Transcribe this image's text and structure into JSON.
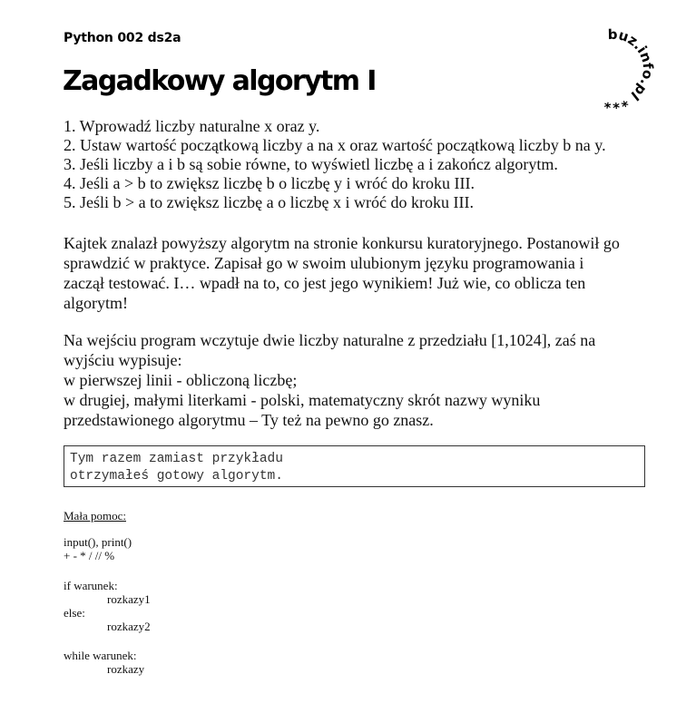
{
  "header": {
    "code": "Python 002 ds2a",
    "title": "Zagadkowy algorytm I"
  },
  "logo": {
    "text": "buz.info.pl ***"
  },
  "steps": [
    "1. Wprowadź liczby naturalne x oraz y.",
    "2. Ustaw wartość początkową liczby a na x oraz wartość początkową liczby b na y.",
    "3. Jeśli liczby a i b są sobie równe, to wyświetl liczbę a i zakończ algorytm.",
    "4. Jeśli a > b to zwiększ liczbę b o liczbę y i wróć do kroku III.",
    "5. Jeśli b > a to zwiększ liczbę a o liczbę x i wróć do kroku III."
  ],
  "story": {
    "lines": [
      "Kajtek znalazł powyższy algorytm na stronie konkursu kuratoryjnego. Postanowił go",
      "sprawdzić w praktyce. Zapisał go w swoim ulubionym języku programowania i",
      "zaczął testować. I… wpadł na to, co jest jego wynikiem! Już wie, co oblicza ten",
      "algorytm!"
    ]
  },
  "task": {
    "lines": [
      "Na wejściu program wczytuje dwie liczby naturalne z przedziału [1,1024], zaś na",
      "wyjściu wypisuje:",
      "w pierwszej linii - obliczoną liczbę;",
      "w drugiej, małymi literkami - polski, matematyczny skrót nazwy wyniku",
      "przedstawionego algorytmu – Ty też na pewno go znasz."
    ]
  },
  "example": {
    "lines": [
      "Tym razem zamiast przykładu",
      "otrzymałeś gotowy algorytm."
    ]
  },
  "help": {
    "heading": "Mała pomoc:",
    "io": "input(), print()",
    "operators": "+ - * / // %",
    "if_line": "if warunek:",
    "if_body": "rozkazy1",
    "else_line": "else:",
    "else_body": "rozkazy2",
    "while_line": "while warunek:",
    "while_body": "rozkazy"
  }
}
